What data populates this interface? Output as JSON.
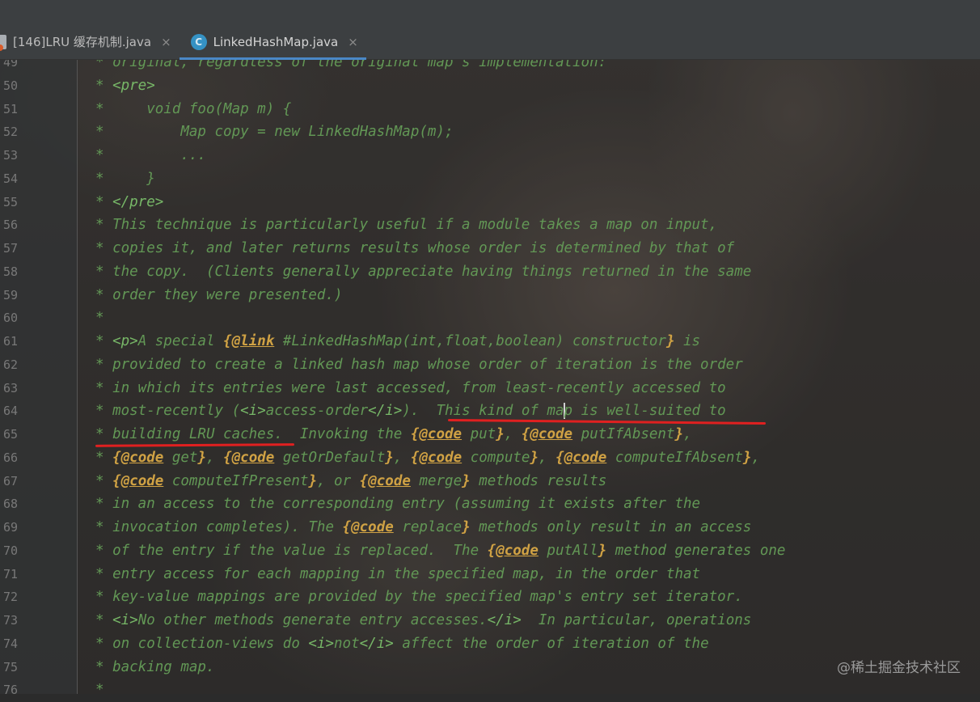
{
  "tabs": [
    {
      "label": "[146]LRU 缓存机制.java",
      "active": false
    },
    {
      "label": "LinkedHashMap.java",
      "active": true
    }
  ],
  "class_icon_letter": "C",
  "close_glyph": "×",
  "editor_lines": [
    {
      "n": "49",
      "segs": [
        {
          "t": "* original, regardless of the original map's implementation:",
          "c": "doc"
        }
      ]
    },
    {
      "n": "50",
      "segs": [
        {
          "t": "* ",
          "c": "doc"
        },
        {
          "t": "<pre>",
          "c": "tag"
        }
      ]
    },
    {
      "n": "51",
      "segs": [
        {
          "t": "*     void foo(Map m) {",
          "c": "doc"
        }
      ]
    },
    {
      "n": "52",
      "segs": [
        {
          "t": "*         Map copy = new LinkedHashMap(m);",
          "c": "doc"
        }
      ]
    },
    {
      "n": "53",
      "segs": [
        {
          "t": "*         ...",
          "c": "doc"
        }
      ]
    },
    {
      "n": "54",
      "segs": [
        {
          "t": "*     }",
          "c": "doc"
        }
      ]
    },
    {
      "n": "55",
      "segs": [
        {
          "t": "* ",
          "c": "doc"
        },
        {
          "t": "</pre>",
          "c": "tag"
        }
      ]
    },
    {
      "n": "56",
      "segs": [
        {
          "t": "* This technique is particularly useful if a module takes a map on input,",
          "c": "doc"
        }
      ]
    },
    {
      "n": "57",
      "segs": [
        {
          "t": "* copies it, and later returns results whose order is determined by that of",
          "c": "doc"
        }
      ]
    },
    {
      "n": "58",
      "segs": [
        {
          "t": "* the copy.  (Clients generally appreciate having things returned in the same",
          "c": "doc"
        }
      ]
    },
    {
      "n": "59",
      "segs": [
        {
          "t": "* order they were presented.)",
          "c": "doc"
        }
      ]
    },
    {
      "n": "60",
      "segs": [
        {
          "t": "*",
          "c": "doc"
        }
      ]
    },
    {
      "n": "61",
      "segs": [
        {
          "t": "* ",
          "c": "doc"
        },
        {
          "t": "<p>",
          "c": "tag"
        },
        {
          "t": "A special ",
          "c": "doc"
        },
        {
          "t": "{",
          "c": "kw"
        },
        {
          "t": "@link",
          "c": "kwu"
        },
        {
          "t": " #LinkedHashMap(int,float,boolean) constructor",
          "c": "doc"
        },
        {
          "t": "}",
          "c": "kw"
        },
        {
          "t": " is",
          "c": "doc"
        }
      ]
    },
    {
      "n": "62",
      "segs": [
        {
          "t": "* provided to create a linked hash map whose order of iteration is the order",
          "c": "doc"
        }
      ]
    },
    {
      "n": "63",
      "segs": [
        {
          "t": "* in which its entries were last accessed, from least-recently accessed to",
          "c": "doc"
        }
      ]
    },
    {
      "n": "64",
      "segs": [
        {
          "t": "* most-recently (",
          "c": "doc"
        },
        {
          "t": "<i>",
          "c": "tag"
        },
        {
          "t": "access-order",
          "c": "doc"
        },
        {
          "t": "</i>",
          "c": "tag"
        },
        {
          "t": ").  This kind of ma",
          "c": "doc"
        },
        {
          "t": "",
          "c": "caret"
        },
        {
          "t": "p is well-suited to",
          "c": "doc"
        }
      ]
    },
    {
      "n": "65",
      "segs": [
        {
          "t": "* building LRU caches.  Invoking the ",
          "c": "doc"
        },
        {
          "t": "{",
          "c": "kw"
        },
        {
          "t": "@code",
          "c": "kwu"
        },
        {
          "t": " put",
          "c": "doc"
        },
        {
          "t": "}",
          "c": "kw"
        },
        {
          "t": ", ",
          "c": "doc"
        },
        {
          "t": "{",
          "c": "kw"
        },
        {
          "t": "@code",
          "c": "kwu"
        },
        {
          "t": " putIfAbsent",
          "c": "doc"
        },
        {
          "t": "}",
          "c": "kw"
        },
        {
          "t": ",",
          "c": "doc"
        }
      ]
    },
    {
      "n": "66",
      "segs": [
        {
          "t": "* ",
          "c": "doc"
        },
        {
          "t": "{",
          "c": "kw"
        },
        {
          "t": "@code",
          "c": "kwu"
        },
        {
          "t": " get",
          "c": "doc"
        },
        {
          "t": "}",
          "c": "kw"
        },
        {
          "t": ", ",
          "c": "doc"
        },
        {
          "t": "{",
          "c": "kw"
        },
        {
          "t": "@code",
          "c": "kwu"
        },
        {
          "t": " getOrDefault",
          "c": "doc"
        },
        {
          "t": "}",
          "c": "kw"
        },
        {
          "t": ", ",
          "c": "doc"
        },
        {
          "t": "{",
          "c": "kw"
        },
        {
          "t": "@code",
          "c": "kwu"
        },
        {
          "t": " compute",
          "c": "doc"
        },
        {
          "t": "}",
          "c": "kw"
        },
        {
          "t": ", ",
          "c": "doc"
        },
        {
          "t": "{",
          "c": "kw"
        },
        {
          "t": "@code",
          "c": "kwu"
        },
        {
          "t": " computeIfAbsent",
          "c": "doc"
        },
        {
          "t": "}",
          "c": "kw"
        },
        {
          "t": ",",
          "c": "doc"
        }
      ]
    },
    {
      "n": "67",
      "segs": [
        {
          "t": "* ",
          "c": "doc"
        },
        {
          "t": "{",
          "c": "kw"
        },
        {
          "t": "@code",
          "c": "kwu"
        },
        {
          "t": " computeIfPresent",
          "c": "doc"
        },
        {
          "t": "}",
          "c": "kw"
        },
        {
          "t": ", or ",
          "c": "doc"
        },
        {
          "t": "{",
          "c": "kw"
        },
        {
          "t": "@code",
          "c": "kwu"
        },
        {
          "t": " merge",
          "c": "doc"
        },
        {
          "t": "}",
          "c": "kw"
        },
        {
          "t": " methods results",
          "c": "doc"
        }
      ]
    },
    {
      "n": "68",
      "segs": [
        {
          "t": "* in an access to the corresponding entry (assuming it exists after the",
          "c": "doc"
        }
      ]
    },
    {
      "n": "69",
      "segs": [
        {
          "t": "* invocation completes). The ",
          "c": "doc"
        },
        {
          "t": "{",
          "c": "kw"
        },
        {
          "t": "@code",
          "c": "kwu"
        },
        {
          "t": " replace",
          "c": "doc"
        },
        {
          "t": "}",
          "c": "kw"
        },
        {
          "t": " methods only result in an access",
          "c": "doc"
        }
      ]
    },
    {
      "n": "70",
      "segs": [
        {
          "t": "* of the entry if the value is replaced.  The ",
          "c": "doc"
        },
        {
          "t": "{",
          "c": "kw"
        },
        {
          "t": "@code",
          "c": "kwu"
        },
        {
          "t": " putAll",
          "c": "doc"
        },
        {
          "t": "}",
          "c": "kw"
        },
        {
          "t": " method generates one",
          "c": "doc"
        }
      ]
    },
    {
      "n": "71",
      "segs": [
        {
          "t": "* entry access for each mapping in the specified map, in the order that",
          "c": "doc"
        }
      ]
    },
    {
      "n": "72",
      "segs": [
        {
          "t": "* key-value mappings are provided by the specified map's entry set iterator.",
          "c": "doc"
        }
      ]
    },
    {
      "n": "73",
      "segs": [
        {
          "t": "* ",
          "c": "doc"
        },
        {
          "t": "<i>",
          "c": "tag"
        },
        {
          "t": "No other methods generate entry accesses.",
          "c": "doc"
        },
        {
          "t": "</i>",
          "c": "tag"
        },
        {
          "t": "  In particular, operations",
          "c": "doc"
        }
      ]
    },
    {
      "n": "74",
      "segs": [
        {
          "t": "* on collection-views do ",
          "c": "doc"
        },
        {
          "t": "<i>",
          "c": "tag"
        },
        {
          "t": "not",
          "c": "doc"
        },
        {
          "t": "</i>",
          "c": "tag"
        },
        {
          "t": " affect the order of iteration of the",
          "c": "doc"
        }
      ]
    },
    {
      "n": "75",
      "segs": [
        {
          "t": "* backing map.",
          "c": "doc"
        }
      ]
    },
    {
      "n": "76",
      "segs": [
        {
          "t": "*",
          "c": "doc"
        }
      ]
    }
  ],
  "watermark": "@稀土掘金技术社区"
}
